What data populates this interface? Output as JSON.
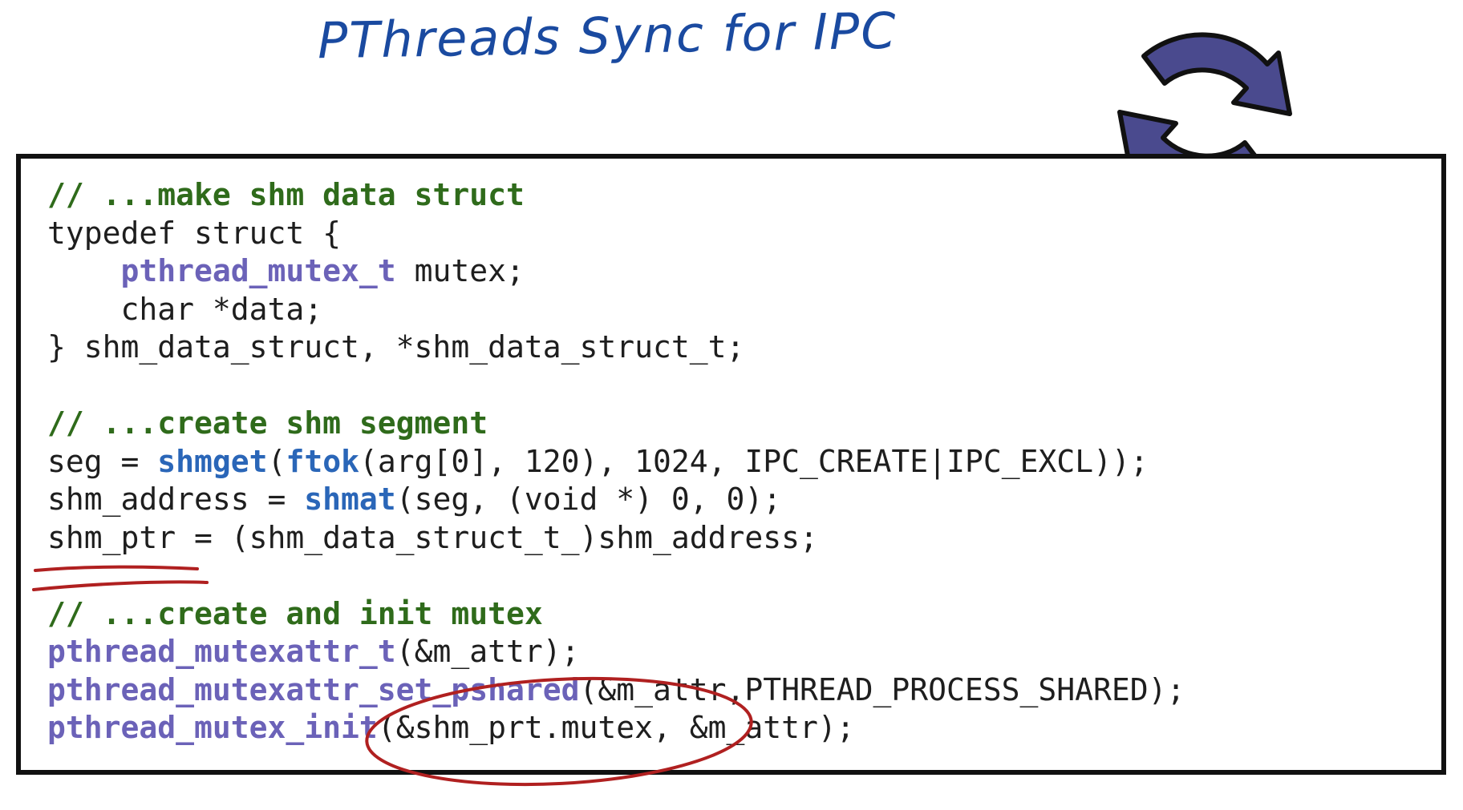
{
  "title": "PThreads Sync for IPC",
  "icon": {
    "name": "sync-icon",
    "color": "#4a4a8e"
  },
  "colors": {
    "comment": "#2f6b1b",
    "type": "#6b62b8",
    "function": "#2a66b8",
    "text": "#1e1e1e",
    "annotation": "#b02020"
  },
  "code": {
    "comment1": "// ...make shm data struct",
    "l2": "typedef struct {",
    "l3_type": "pthread_mutex_t",
    "l3_rest": " mutex;",
    "l4": "char *data;",
    "l5": "} shm_data_struct, *shm_data_struct_t;",
    "comment2": "// ...create shm segment",
    "l7_a": "seg = ",
    "l7_fn1": "shmget",
    "l7_b": "(",
    "l7_fn2": "ftok",
    "l7_c": "(arg[0], 120), 1024, IPC_CREATE|IPC_EXCL));",
    "l8_a": "shm_address = ",
    "l8_fn": "shmat",
    "l8_b": "(seg, (void *) 0, 0);",
    "l9": "shm_ptr = (shm_data_struct_t_)shm_address;",
    "comment3": "// ...create and init mutex",
    "l11_type": "pthread_mutexattr_t",
    "l11_rest": "(&m_attr);",
    "l12_fn": "pthread_mutexattr_set_pshared",
    "l12_rest": "(&m_attr,PTHREAD_PROCESS_SHARED);",
    "l13_fn": "pthread_mutex_init",
    "l13_rest": "(&shm_prt.mutex, &m_attr);"
  }
}
